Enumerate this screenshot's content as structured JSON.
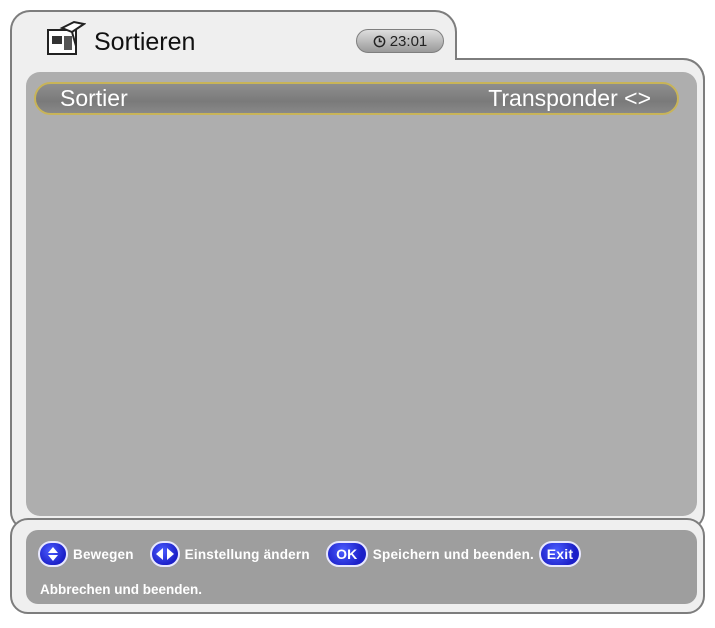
{
  "header": {
    "title": "Sortieren",
    "clock": "23:01",
    "icon": "sort-settings-icon"
  },
  "main": {
    "setting": {
      "label": "Sortier",
      "value": "Transponder <>"
    }
  },
  "help": {
    "move_label": "Bewegen",
    "change_label": "Einstellung ändern",
    "ok_key": "OK",
    "save_label": "Speichern und beenden.",
    "exit_key": "Exit",
    "cancel_label": "Abbrechen und beenden."
  },
  "colors": {
    "panel": "#aeaeae",
    "highlight_border": "#c8b458",
    "key_blue": "#1b1fc8"
  }
}
